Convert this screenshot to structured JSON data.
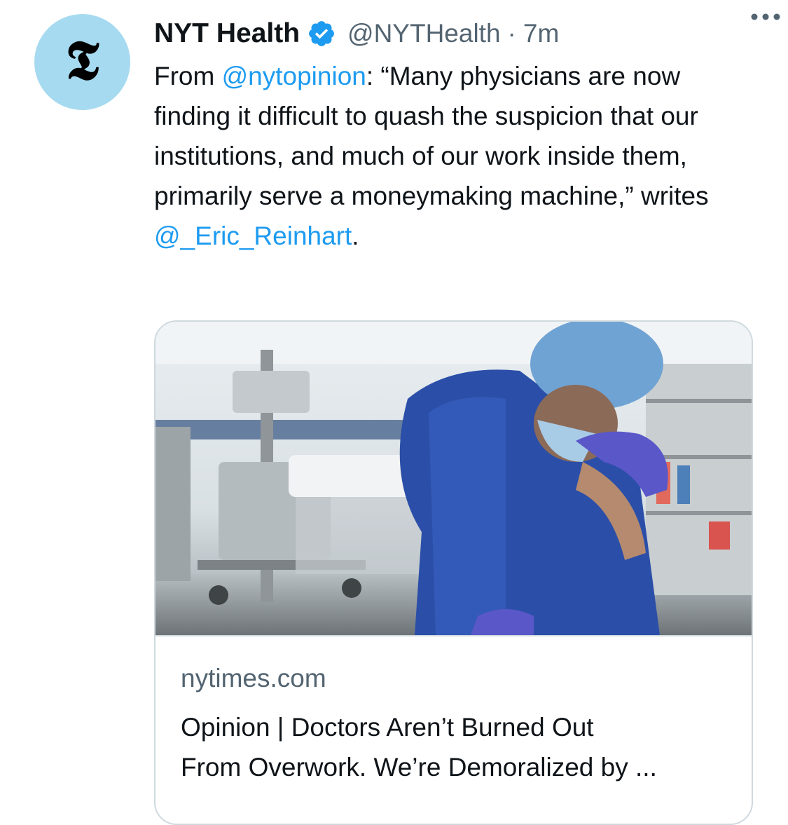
{
  "author": {
    "display_name": "NYT Health",
    "handle": "@NYTHealth",
    "separator": "·",
    "time": "7m",
    "avatar_glyph": "𝕿",
    "verified_color": "#1d9bf0",
    "avatar_bg": "#a6daf0"
  },
  "tweet": {
    "prefix": "From ",
    "mention_1": "@nytopinion",
    "body": ": “Many physicians are now finding it difficult to quash the suspicion that our institutions, and much of our work inside them, primarily serve a moneymaking machine,” writes ",
    "mention_2": "@_Eric_Reinhart",
    "suffix": "."
  },
  "card": {
    "domain": "nytimes.com",
    "title_line_1": "Opinion | Doctors Aren’t Burned Out",
    "title_line_2": "From Overwork. We’re Demoralized by ...",
    "image_icon": "photo-doctor-in-scrubs"
  },
  "icons": {
    "more": "more-icon",
    "verified": "verified-badge-icon"
  }
}
